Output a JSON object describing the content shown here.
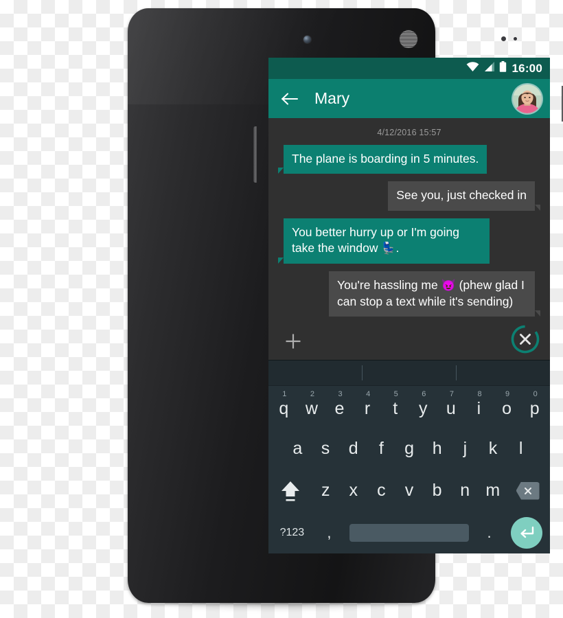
{
  "theme": {
    "status_bar_bg": "#0d5b4f",
    "app_bar_bg": "#0c7f6f",
    "outgoing_bubble_bg": "#0c8072",
    "incoming_bubble_bg": "#4a4a4a",
    "conversation_bg": "#303030",
    "keyboard_bg": "#263238",
    "enter_key_bg": "#7fcfc0",
    "accent": "#0c8072"
  },
  "status_bar": {
    "clock": "16:00",
    "wifi_icon": "wifi-icon",
    "signal_icon": "cellular-signal-icon",
    "battery_icon": "battery-full-icon"
  },
  "app_bar": {
    "back_icon": "back-arrow-icon",
    "title": "Mary",
    "avatar_icon": "contact-avatar"
  },
  "conversation": {
    "date_divider": "4/12/2016 15:57",
    "messages": [
      {
        "direction": "out",
        "text": "The plane is boarding in 5 minutes."
      },
      {
        "direction": "in",
        "text": "See you, just checked in"
      },
      {
        "direction": "out",
        "text": "You better hurry up or I'm going take the window ",
        "emoji": "💺",
        "text_after": "."
      },
      {
        "direction": "in",
        "text": "You're hassling me ",
        "emoji": "😈",
        "text_after": " (phew glad I can stop a text while it's sending)"
      }
    ],
    "attach_icon": "plus-attach-icon",
    "cancel_send_icon": "cancel-send-icon"
  },
  "keyboard": {
    "suggestions": [
      "",
      "",
      ""
    ],
    "row_top": [
      {
        "letter": "q",
        "num": "1"
      },
      {
        "letter": "w",
        "num": "2"
      },
      {
        "letter": "e",
        "num": "3"
      },
      {
        "letter": "r",
        "num": "4"
      },
      {
        "letter": "t",
        "num": "5"
      },
      {
        "letter": "y",
        "num": "6"
      },
      {
        "letter": "u",
        "num": "7"
      },
      {
        "letter": "i",
        "num": "8"
      },
      {
        "letter": "o",
        "num": "9"
      },
      {
        "letter": "p",
        "num": "0"
      }
    ],
    "row_mid": [
      "a",
      "s",
      "d",
      "f",
      "g",
      "h",
      "j",
      "k",
      "l"
    ],
    "row_bot": [
      "z",
      "x",
      "c",
      "v",
      "b",
      "n",
      "m"
    ],
    "shift_icon": "shift-caps-icon",
    "backspace_icon": "backspace-icon",
    "symbols_label": "?123",
    "comma_label": ",",
    "space_label": "",
    "period_label": ".",
    "enter_icon": "enter-return-icon"
  },
  "device": {
    "front_camera": "front-camera",
    "earpiece": "earpiece-speaker",
    "power_button": "power-button",
    "volume_rocker": "volume-rocker"
  }
}
